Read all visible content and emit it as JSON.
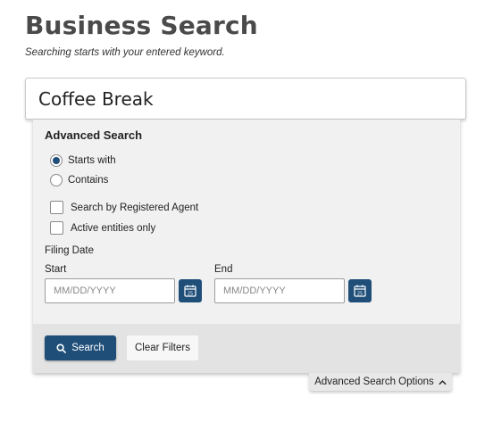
{
  "header": {
    "title": "Business Search",
    "subtitle": "Searching starts with your entered keyword."
  },
  "search": {
    "value": "Coffee Break"
  },
  "advanced": {
    "heading": "Advanced Search",
    "match_options": [
      {
        "label": "Starts with",
        "checked": true
      },
      {
        "label": "Contains",
        "checked": false
      }
    ],
    "checkboxes": [
      {
        "label": "Search by Registered Agent",
        "checked": false
      },
      {
        "label": "Active entities only",
        "checked": false
      }
    ],
    "filing_date": {
      "label": "Filing Date",
      "start_label": "Start",
      "end_label": "End",
      "start_placeholder": "MM/DD/YYYY",
      "end_placeholder": "MM/DD/YYYY",
      "calendar_icon_text": "25"
    },
    "search_button": "Search",
    "clear_button": "Clear Filters",
    "toggle_label": "Advanced Search Options"
  },
  "colors": {
    "primary": "#1f4e79",
    "panel_bg": "#f1f1f1",
    "footer_bg": "#e3e3e3"
  },
  "icons": {
    "search_button_icon": "search-icon",
    "calendar": "calendar-icon",
    "toggle": "chevron-up-icon"
  }
}
